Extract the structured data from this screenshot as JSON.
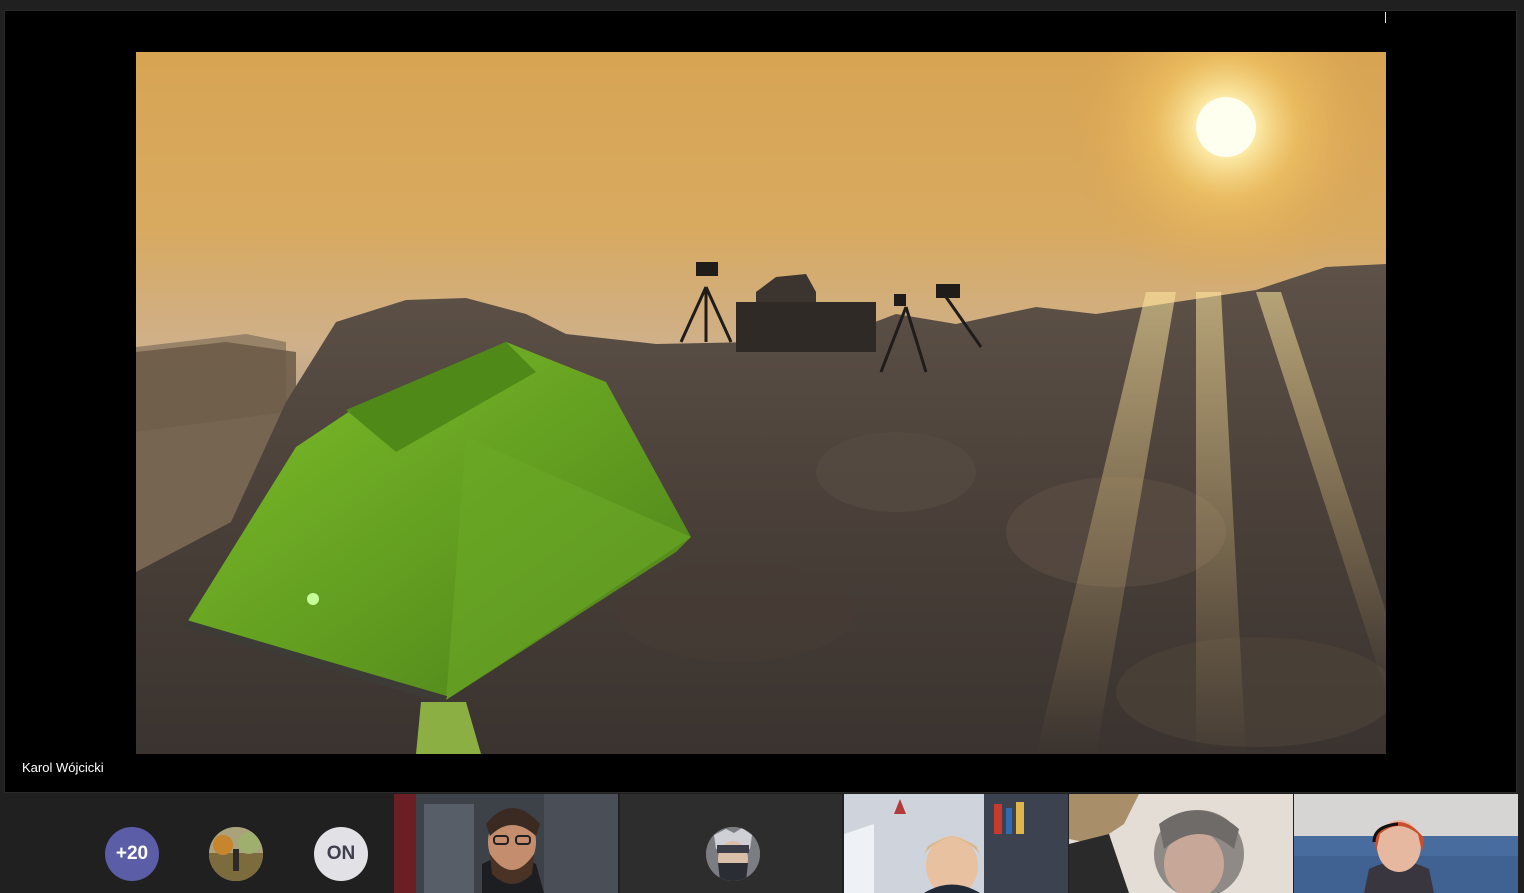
{
  "presenter": {
    "name": "Karol Wójcicki"
  },
  "roster": {
    "more_count": "+20",
    "initials_badge": "ON"
  },
  "colors": {
    "more_badge": "#5b5ea6",
    "initials_badge_bg": "#e1e1e6",
    "initials_badge_text": "#3f3f4d",
    "background": "#202020"
  },
  "icons": {
    "overflow": "participants-overflow-icon",
    "avatar": "avatar-photo"
  }
}
